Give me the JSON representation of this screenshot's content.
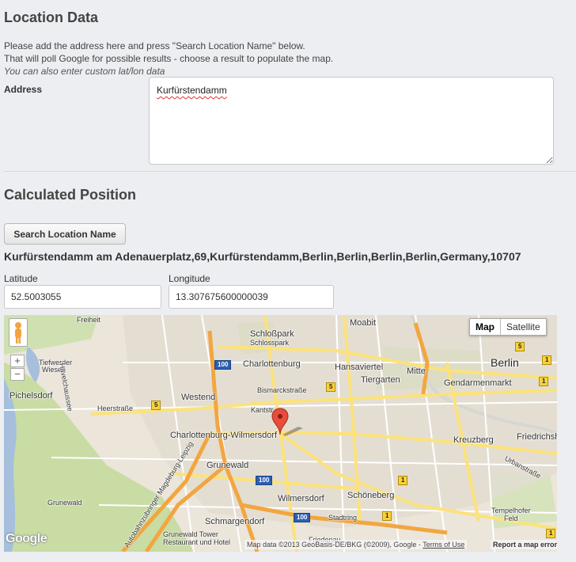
{
  "location_section": {
    "title": "Location Data",
    "help_line1": "Please add the address here and press \"Search Location Name\" below.",
    "help_line2": "That will poll Google for possible results - choose a result to populate the map.",
    "help_line3": "You can also enter custom lat/lon data",
    "address_label": "Address",
    "address_value": "Kurfürstendamm"
  },
  "position_section": {
    "title": "Calculated Position",
    "search_button": "Search Location Name",
    "result": "Kurfürstendamm am Adenauerplatz,69,Kurfürstendamm,Berlin,Berlin,Berlin,Berlin,Germany,10707",
    "latitude_label": "Latitude",
    "latitude_value": "52.5003055",
    "longitude_label": "Longitude",
    "longitude_value": "13.307675600000039"
  },
  "map": {
    "type_map": "Map",
    "type_satellite": "Satellite",
    "zoom_in": "+",
    "zoom_out": "−",
    "logo": "Google",
    "attribution": "Map data ©2013 GeoBasis-DE/BKG (©2009), Google -",
    "terms": "Terms of Use",
    "report": "Report a map error",
    "labels": {
      "freiheit": "Freiheit",
      "moabit": "Moabit",
      "schlosspark": "Schloßpark",
      "schlosspark_sub": "Schlosspark",
      "charlottenburg": "Charlottenburg",
      "hansaviertel": "Hansaviertel",
      "mitte": "Mitte",
      "berlin": "Berlin",
      "tiefwerder": "Tiefwerder",
      "wiesen": "Wiesen",
      "havelchaussee": "Havelchaussee",
      "westend": "Westend",
      "bismarckstrasse": "Bismarckstraße",
      "tiergarten": "Tiergarten",
      "gendarmenmarkt": "Gendarmenmarkt",
      "pichelsdorf": "Pichelsdorf",
      "heerstrasse": "Heerstraße",
      "kantstr": "Kantstr.",
      "charlottenburg_wilmersdorf": "Charlottenburg-Wilmersdorf",
      "kreuzberg": "Kreuzberg",
      "friedrichshain": "Friedrichsh",
      "urbanstrasse": "Urbanstraße",
      "grunewald": "Grunewald",
      "wilmersdorf": "Wilmersdorf",
      "schoeneberg": "Schöneberg",
      "grunewald_place": "Grunewald",
      "autobahnzubringer": "Autobahnzubringer Magdeburg-Leipzig",
      "tempelhofer": "Tempelhofer",
      "feld": "Feld",
      "schmargendorf": "Schmargendorf",
      "stadtring": "Stadtring",
      "grunewald_tower": "Grunewald Tower",
      "restaurant": "Restaurant und Hotel",
      "friedenau": "Friedenau",
      "shield_100": "100",
      "shield_5": "5",
      "shield_1": "1"
    }
  }
}
